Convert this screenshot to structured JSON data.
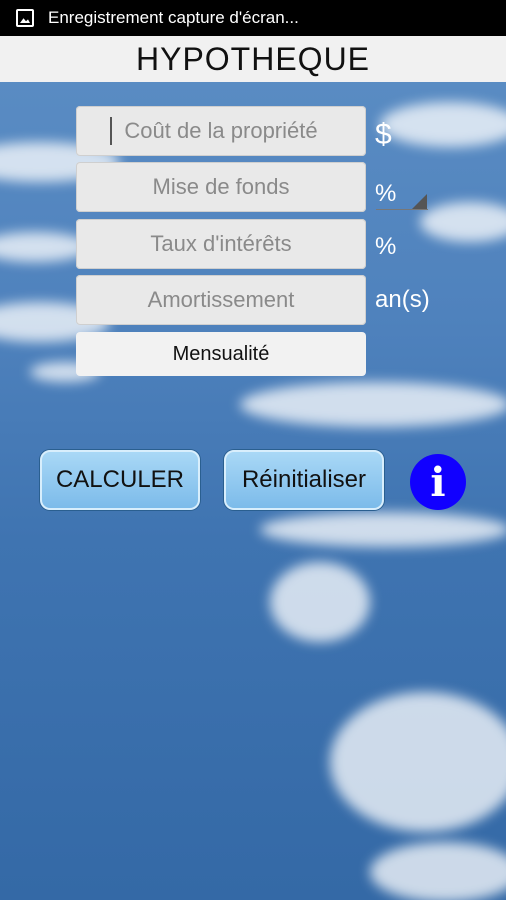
{
  "statusbar": {
    "notification": "Enregistrement capture d'écran..."
  },
  "app": {
    "title": "HYPOTHEQUE"
  },
  "fields": [
    {
      "placeholder": "Coût de la propriété",
      "unit": "$"
    },
    {
      "placeholder": "Mise de fonds",
      "unit": "%"
    },
    {
      "placeholder": "Taux d'intérêts",
      "unit": "%"
    },
    {
      "placeholder": "Amortissement",
      "unit": "an(s)"
    }
  ],
  "result": {
    "label": "Mensualité"
  },
  "buttons": {
    "calculate": "CALCULER",
    "reset": "Réinitialiser",
    "info": "i"
  }
}
